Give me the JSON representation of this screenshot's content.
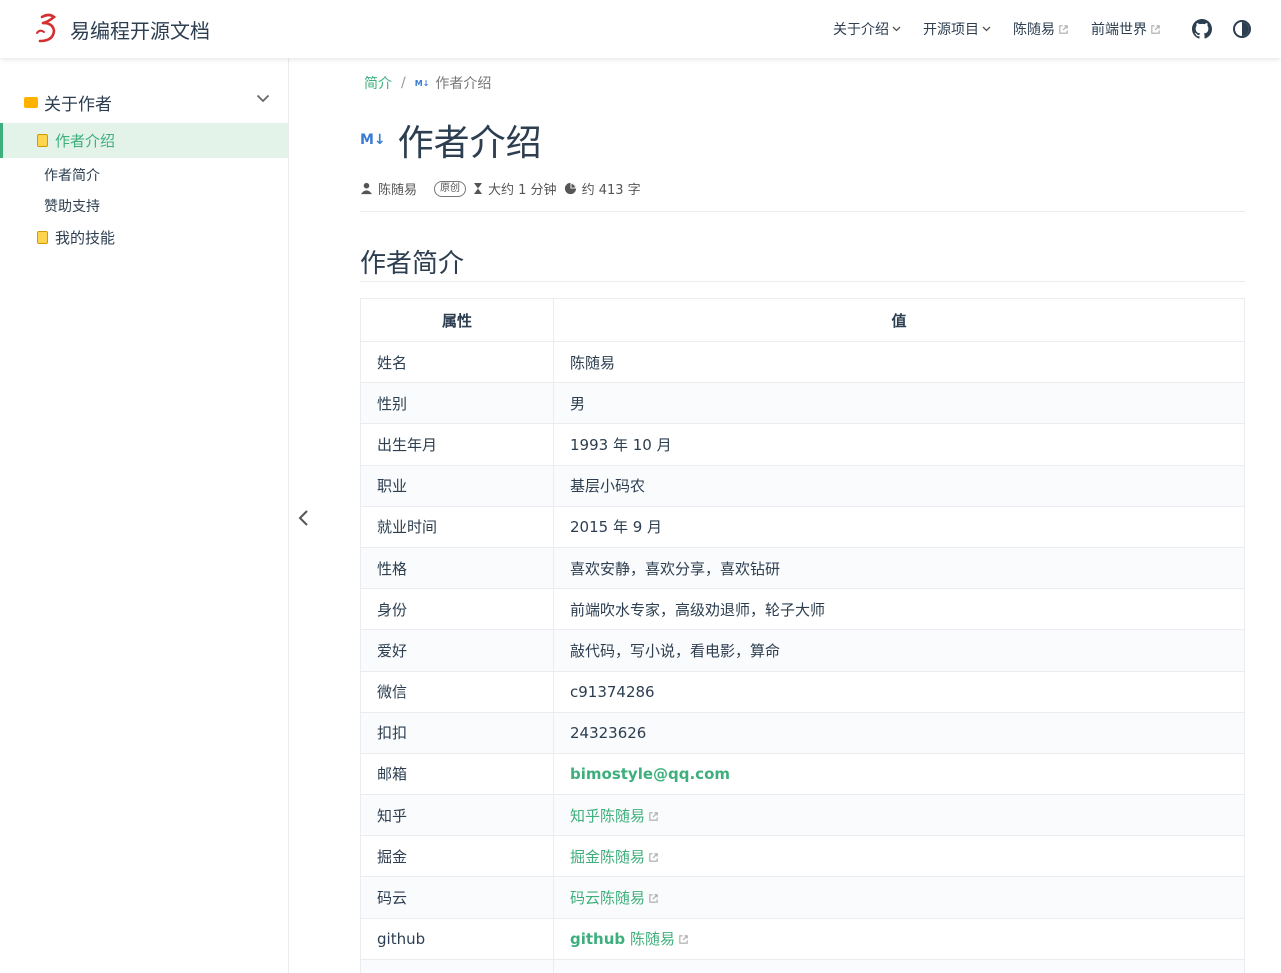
{
  "brand": {
    "title": "易编程开源文档"
  },
  "nav": {
    "items": [
      {
        "label": "关于介绍",
        "type": "dropdown"
      },
      {
        "label": "开源项目",
        "type": "dropdown"
      },
      {
        "label": "陈随易",
        "type": "external"
      },
      {
        "label": "前端世界",
        "type": "external"
      }
    ],
    "icons": [
      "github-icon",
      "theme-toggle-icon"
    ]
  },
  "sidebar": {
    "group_label": "关于作者",
    "active_item": "作者介绍",
    "sub_items": [
      "作者简介",
      "赞助支持"
    ],
    "other_item": "我的技能"
  },
  "breadcrumb": {
    "home": "简介",
    "separator": "/",
    "current": "作者介绍"
  },
  "page": {
    "title": "作者介绍",
    "md_badge": "M↓",
    "author": "陈随易",
    "original_badge": "原创",
    "read_time": "大约 1 分钟",
    "word_count": "约 413 字",
    "section_title": "作者简介"
  },
  "table": {
    "headers": [
      "属性",
      "值"
    ],
    "rows": [
      {
        "key": "姓名",
        "value": "陈随易"
      },
      {
        "key": "性别",
        "value": "男"
      },
      {
        "key": "出生年月",
        "value": "1993 年 10 月"
      },
      {
        "key": "职业",
        "value": "基层小码农"
      },
      {
        "key": "就业时间",
        "value": "2015 年 9 月"
      },
      {
        "key": "性格",
        "value": "喜欢安静，喜欢分享，喜欢钻研"
      },
      {
        "key": "身份",
        "value": "前端吹水专家，高级劝退师，轮子大师"
      },
      {
        "key": "爱好",
        "value": "敲代码，写小说，看电影，算命"
      },
      {
        "key": "微信",
        "value": "c91374286"
      },
      {
        "key": "扣扣",
        "value": "24323626"
      },
      {
        "key": "邮箱",
        "value": "bimostyle@qq.com"
      },
      {
        "key": "知乎",
        "value": "知乎陈随易"
      },
      {
        "key": "掘金",
        "value": "掘金陈随易"
      },
      {
        "key": "码云",
        "value": "码云陈随易"
      },
      {
        "key": "github",
        "value_bold": "github",
        "value": "陈随易"
      }
    ]
  },
  "colors": {
    "accent": "#3eaf7c",
    "text": "#2c3e50",
    "active_bg": "#e3f3ea"
  }
}
